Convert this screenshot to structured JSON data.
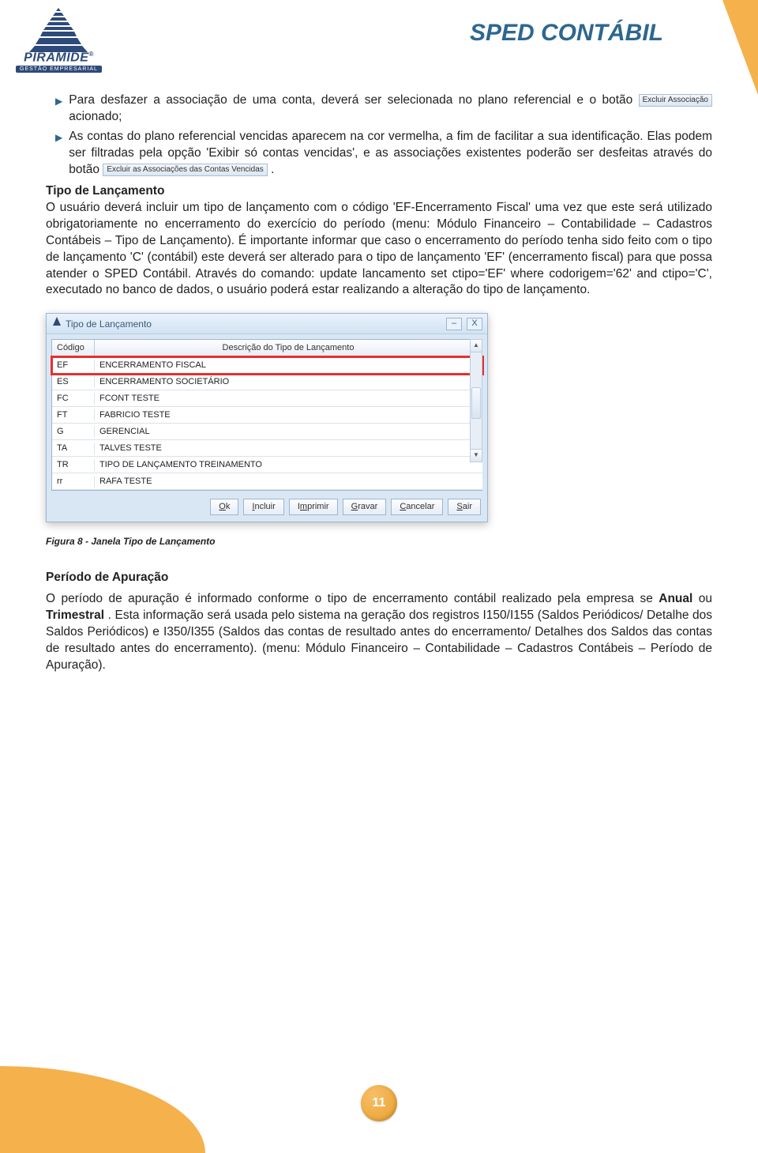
{
  "header": {
    "logo_name": "PIRÂMIDE",
    "logo_tagline": "GESTÃO EMPRESARIAL",
    "doc_title": "SPED CONTÁBIL"
  },
  "bullets": {
    "b1_pre": "Para desfazer a associação de uma conta, deverá ser selecionada no plano referencial e o botão ",
    "b1_btn": "Excluir Associação",
    "b1_post": " acionado;",
    "b2_pre": "As contas do plano referencial vencidas aparecem na cor vermelha, a fim de facilitar a sua identificação. Elas podem ser filtradas pela opção 'Exibir só contas vencidas', e as associações existentes poderão ser desfeitas através do botão ",
    "b2_btn": "Excluir as Associações das Contas Vencidas",
    "b2_post": "."
  },
  "tipo_heading": "Tipo de Lançamento",
  "tipo_para": " O usuário deverá incluir um tipo de lançamento com o código 'EF-Encerramento Fiscal' uma vez que este será utilizado obrigatoriamente no encerramento do exercício do período (menu: Módulo Financeiro – Contabilidade – Cadastros Contábeis – Tipo de Lançamento). É importante informar que caso o encerramento do período tenha sido feito com o tipo de lançamento 'C' (contábil) este deverá ser alterado para o tipo de lançamento 'EF' (encerramento fiscal) para que possa atender o SPED Contábil. Através do comando: update lancamento set ctipo='EF' where codorigem='62' and ctipo='C', executado no banco de dados, o usuário poderá estar realizando a alteração do tipo de lançamento.",
  "dialog": {
    "title": "Tipo de Lançamento",
    "col_code": "Código",
    "col_desc": "Descrição do Tipo de Lançamento",
    "rows": [
      {
        "code": "EF",
        "desc": "ENCERRAMENTO FISCAL"
      },
      {
        "code": "ES",
        "desc": "ENCERRAMENTO SOCIETÁRIO"
      },
      {
        "code": "FC",
        "desc": "FCONT TESTE"
      },
      {
        "code": "FT",
        "desc": "FABRICIO TESTE"
      },
      {
        "code": "G",
        "desc": "GERENCIAL"
      },
      {
        "code": "TA",
        "desc": "TALVES TESTE"
      },
      {
        "code": "TR",
        "desc": "TIPO DE LANÇAMENTO TREINAMENTO"
      },
      {
        "code": "rr",
        "desc": "RAFA TESTE"
      }
    ],
    "buttons": {
      "ok": "Ok",
      "incluir": "Incluir",
      "imprimir": "Imprimir",
      "gravar": "Gravar",
      "cancelar": "Cancelar",
      "sair": "Sair"
    }
  },
  "fig_caption": "Figura 8 - Janela Tipo de Lançamento",
  "periodo": {
    "heading": "Período de Apuração",
    "p_pre": "O período de apuração é informado conforme o tipo de encerramento contábil realizado pela empresa se ",
    "anual": "Anual",
    "ou": " ou ",
    "trimestral": "Trimestral",
    "p_post": ". Esta informação será usada pelo sistema na geração dos registros I150/I155 (Saldos Periódicos/ Detalhe dos Saldos Periódicos) e I350/I355 (Saldos das contas de resultado antes do encerramento/ Detalhes dos Saldos das contas de resultado antes do encerramento). (menu: Módulo Financeiro – Contabilidade – Cadastros Contábeis – Período de Apuração)."
  },
  "page_number": "11"
}
